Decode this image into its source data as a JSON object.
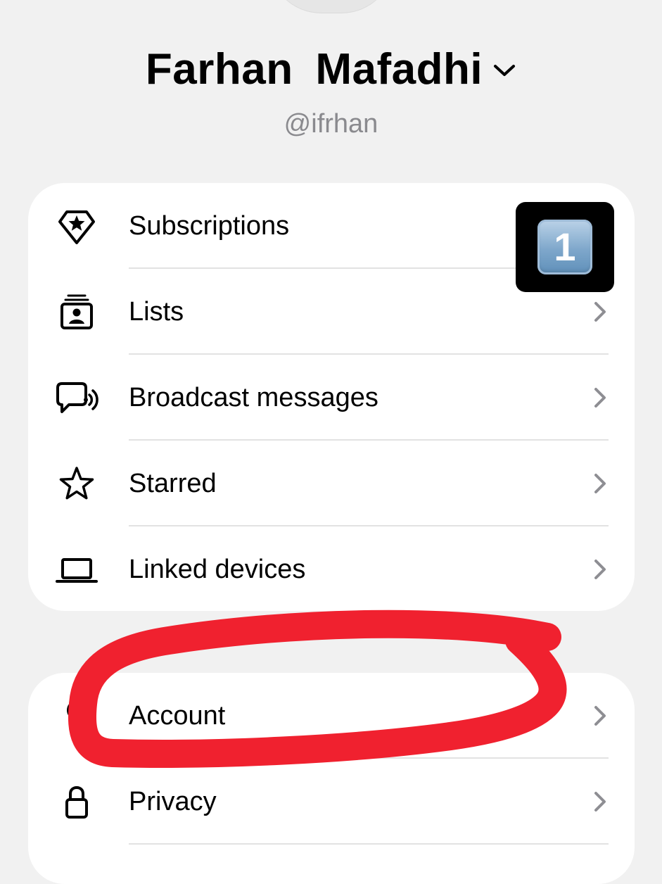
{
  "profile": {
    "name": "Farhan  Mafadhi",
    "handle": "@ifrhan"
  },
  "badge": {
    "number": "1"
  },
  "menu_group_1": [
    {
      "label": "Subscriptions",
      "icon": "subscriptions-star-icon"
    },
    {
      "label": "Lists",
      "icon": "lists-icon"
    },
    {
      "label": "Broadcast messages",
      "icon": "broadcast-icon"
    },
    {
      "label": "Starred",
      "icon": "star-icon"
    },
    {
      "label": "Linked devices",
      "icon": "laptop-icon"
    }
  ],
  "menu_group_2": [
    {
      "label": "Account",
      "icon": "key-icon"
    },
    {
      "label": "Privacy",
      "icon": "lock-icon"
    }
  ],
  "annotation": {
    "color": "#f0212f"
  }
}
